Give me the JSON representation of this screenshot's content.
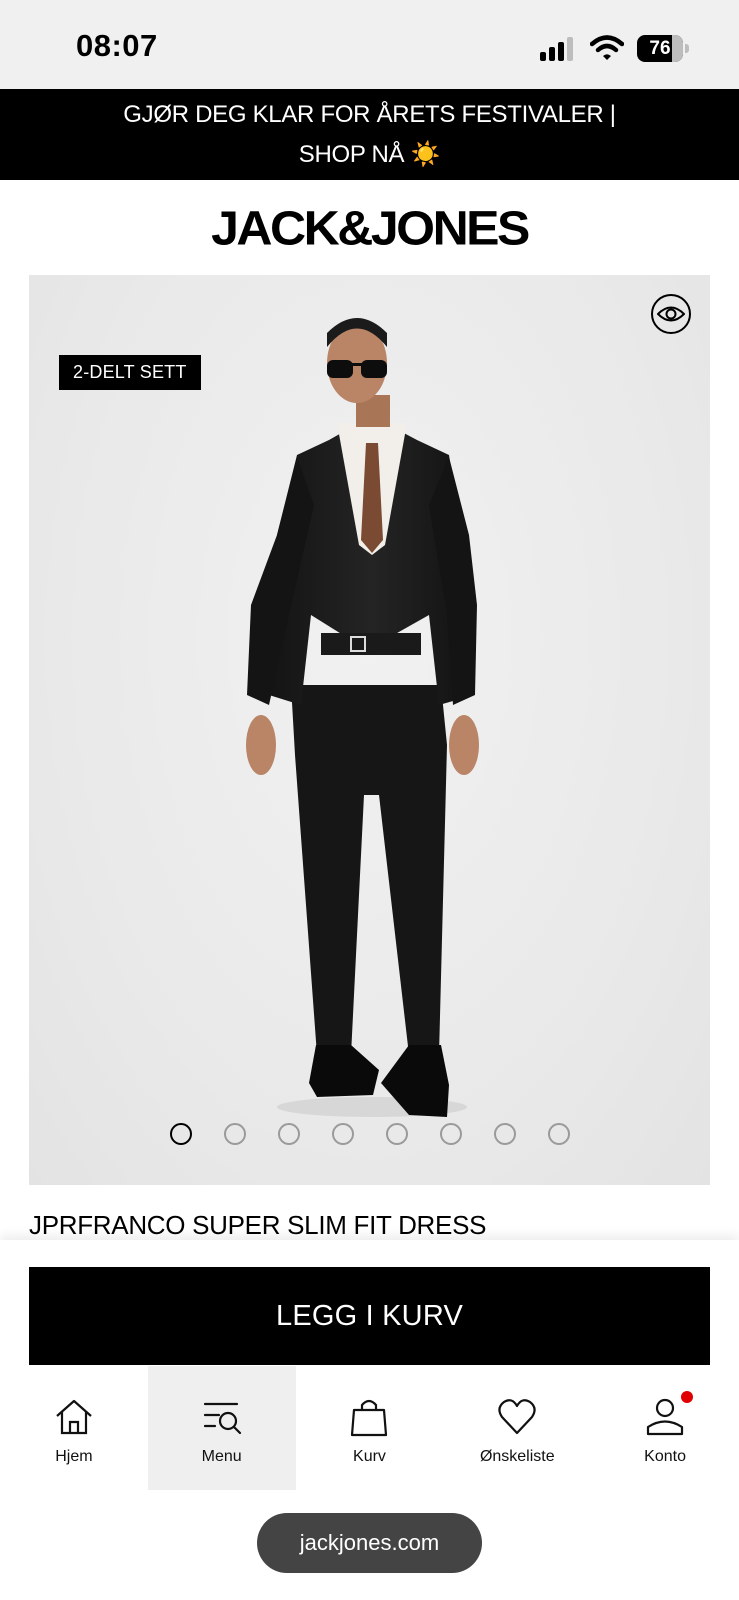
{
  "status_bar": {
    "time": "08:07",
    "battery": "76",
    "battery_level": 0.76,
    "icons": [
      "signal-icon",
      "wifi-icon",
      "battery-icon"
    ]
  },
  "promo_banner": {
    "text": "GJØR DEG KLAR FOR ÅRETS FESTIVALER | SHOP NÅ ☀️"
  },
  "header": {
    "logo": "JACK&JONES"
  },
  "product": {
    "badge": "2-DELT SETT",
    "image_count": 8,
    "active_image_index": 0,
    "title": "JPRFRANCO SUPER SLIM FIT DRESS",
    "view_icon": "eye-icon"
  },
  "actions": {
    "add_to_cart": "LEGG I KURV"
  },
  "bottom_nav": {
    "items": [
      {
        "label": "Hjem",
        "icon": "home-icon"
      },
      {
        "label": "Menu",
        "icon": "menu-search-icon",
        "active": true
      },
      {
        "label": "Kurv",
        "icon": "bag-icon"
      },
      {
        "label": "Ønskeliste",
        "icon": "heart-icon"
      },
      {
        "label": "Konto",
        "icon": "account-icon",
        "notification": true
      }
    ]
  },
  "browser": {
    "url": "jackjones.com"
  },
  "colors": {
    "accent": "#000000",
    "notification": "#e00000",
    "background": "#ffffff"
  }
}
